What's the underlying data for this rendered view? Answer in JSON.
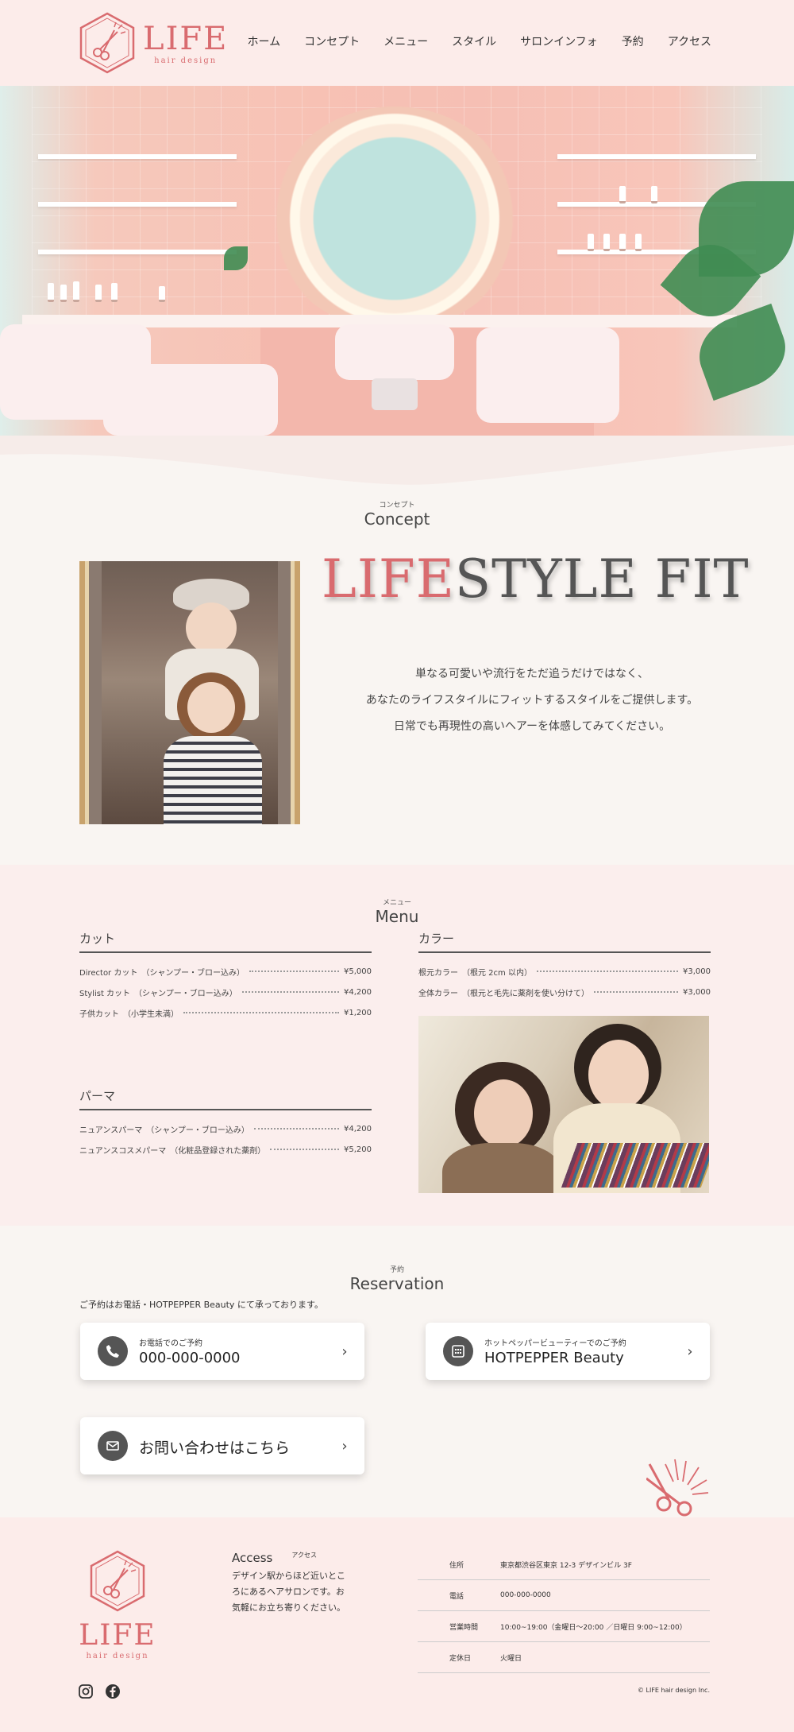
{
  "header": {
    "logo_name": "LIFE",
    "logo_sub": "hair design",
    "nav": [
      "ホーム",
      "コンセプト",
      "メニュー",
      "スタイル",
      "サロンインフォ",
      "予約",
      "アクセス"
    ]
  },
  "concept": {
    "label_small": "コンセプト",
    "label_big": "Concept",
    "tagline_accent": "LIFE",
    "tagline_rest": "STYLE FIT",
    "lines": [
      "単なる可愛いや流行をただ追うだけではなく、",
      "あなたのライフスタイルにフィットするスタイルをご提供します。",
      "日常でも再現性の高いヘアーを体感してみてください。"
    ]
  },
  "menu": {
    "label_small": "メニュー",
    "label_big": "Menu",
    "cut": {
      "title": "カット",
      "items": [
        {
          "name": "Director カット　（シャンプー・ブロー込み）",
          "price": "¥5,000"
        },
        {
          "name": "Stylist カット　（シャンプー・ブロー込み）",
          "price": "¥4,200"
        },
        {
          "name": "子供カット　（小学生未満）",
          "price": "¥1,200"
        }
      ]
    },
    "color": {
      "title": "カラー",
      "items": [
        {
          "name": "根元カラー　（根元 2cm 以内）",
          "price": "¥3,000"
        },
        {
          "name": "全体カラー　（根元と毛先に薬剤を使い分けて）",
          "price": "¥3,000"
        }
      ]
    },
    "perm": {
      "title": "パーマ",
      "items": [
        {
          "name": "ニュアンスパーマ　（シャンプー・ブロー込み）",
          "price": "¥4,200"
        },
        {
          "name": "ニュアンスコスメパーマ　（化粧品登録された薬剤）",
          "price": "¥5,200"
        }
      ]
    }
  },
  "reservation": {
    "label_small": "予約",
    "label_big": "Reservation",
    "note": "ご予約はお電話・HOTPEPPER Beauty にて承っております。",
    "phone_small": "お電話でのご予約",
    "phone_big": "000-000-0000",
    "hp_small": "ホットペッパービューティーでのご予約",
    "hp_big": "HOTPEPPER Beauty",
    "contact": "お問い合わせはこちら",
    "chev": "›"
  },
  "footer": {
    "logo_name": "LIFE",
    "logo_sub": "hair design",
    "access_title": "Access",
    "access_small": "アクセス",
    "access_text": "デザイン駅からほど近いところにあるヘアサロンです。お気軽にお立ち寄りください。",
    "info": [
      {
        "k": "住所",
        "v": "東京都渋谷区東京 12-3 デザインビル 3F"
      },
      {
        "k": "電話",
        "v": "000-000-0000"
      },
      {
        "k": "営業時間",
        "v": "10:00~19:00（金曜日～20:00 ／日曜日 9:00~12:00）"
      },
      {
        "k": "定休日",
        "v": "火曜日"
      }
    ],
    "copyright": "© LIFE hair design Inc."
  },
  "colors": {
    "accent": "#d96b6f",
    "bg": "#f9f5f2",
    "pink_bg": "#fbeeed"
  },
  "icons": [
    "hexagon-scissors-logo-icon",
    "phone-icon",
    "calendar-icon",
    "mail-icon",
    "instagram-icon",
    "facebook-icon",
    "scissors-icon"
  ]
}
